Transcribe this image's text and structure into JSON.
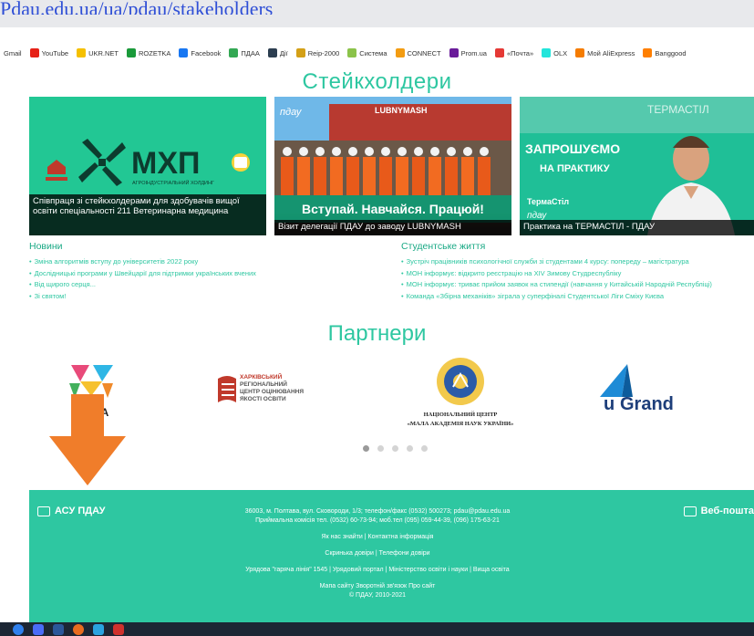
{
  "top_link": "Pdau.edu.ua/ua/pdau/stakeholders",
  "bookmarks": [
    {
      "label": "Gmail",
      "color": "#ffffff"
    },
    {
      "label": "YouTube",
      "color": "#e62117"
    },
    {
      "label": "UKR.NET",
      "color": "#f5c000"
    },
    {
      "label": "ROZETKA",
      "color": "#1a9a3a"
    },
    {
      "label": "Facebook",
      "color": "#1877f2"
    },
    {
      "label": "ПДАА",
      "color": "#33a854"
    },
    {
      "label": "Дії",
      "color": "#2c3e50"
    },
    {
      "label": "Reip-2000",
      "color": "#d4a017"
    },
    {
      "label": "Система",
      "color": "#8bc34a"
    },
    {
      "label": "CONNECT",
      "color": "#f39c12"
    },
    {
      "label": "Prom.ua",
      "color": "#6a1b9a"
    },
    {
      "label": "«Почта»",
      "color": "#e53935"
    },
    {
      "label": "OLX",
      "color": "#23e5db"
    },
    {
      "label": "Мой AliExpress",
      "color": "#f57c00"
    },
    {
      "label": "Banggood",
      "color": "#ff7f00"
    }
  ],
  "stakeholders_title": "Стейкхолдери",
  "cards": [
    {
      "caption": "Співпраця зі стейкхолдерами для здобувачів вищої освіти спеціальності 211 Ветеринарна медицина",
      "logo": "МХП",
      "logo_sub": "АГРОІНДУСТРІАЛЬНИЙ ХОЛДИНГ"
    },
    {
      "caption": "Візит делегації ПДАУ до заводу LUBNYMASH",
      "banner": "Вступай. Навчайся. Працюй!",
      "corner": "пдау",
      "sign": "LUBNYMASH"
    },
    {
      "caption": "Практика на ТЕРМАСТІЛ - ПДАУ",
      "headline1": "ЗАПРОШУЄМО",
      "headline2": "НА ПРАКТИКУ",
      "brand": "ТермаСтіл",
      "corner": "пдау",
      "sign": "ТЕРМАСТІЛ"
    }
  ],
  "news": {
    "title": "Новини",
    "items": [
      "Зміна алгоритмів вступу до університетів 2022 року",
      "Дослідницькі програми у Швейцарії для підтримки українських вчених",
      "Від щирого серця...",
      "Зі святом!"
    ]
  },
  "student_life": {
    "title": "Студентське життя",
    "items": [
      "Зустріч працівників психологічної служби зі студентами 4 курсу: попереду – магістратура",
      "МОН інформує: відкрито реєстрацію на XIV Зимову Студреспубліку",
      "МОН інформує: триває прийом заявок на стипендії (навчання у Китайській Народній Республіці)",
      "Команда «Збірна механіків» зіграла у суперфіналі Студентської Ліги Сміху Києва"
    ]
  },
  "partners_title": "Партнери",
  "partners": [
    {
      "label": "BA"
    },
    {
      "label": "ХАРКІВСЬКИЙ РЕГІОНАЛЬНИЙ ЦЕНТР ОЦІНЮВАННЯ ЯКОСТІ ОСВІТИ"
    },
    {
      "label": "НАЦІОНАЛЬНИЙ ЦЕНТР «МАЛА АКАДЕМІЯ НАУК УКРАЇНИ»"
    },
    {
      "label": "Grand"
    }
  ],
  "footer": {
    "brand": "АСУ ПДАУ",
    "mail": "Веб-пошта",
    "address": "36003, м. Полтава, вул. Сковороди, 1/3; телефон/факс (0532) 500273; pdau@pdau.edu.ua",
    "admissions": "Приймальна комісія тел. (0532) 60-73-94; моб.тел (095) 059-44-39, (096) 175-63-21",
    "links1": "Як нас знайти | Контактна інформація",
    "links2": "Скринька довіри | Телефони довіри",
    "links3": "Урядова \"гаряча лінія\" 1545 | Урядовий портал | Міністерство освіти і науки | Вища освіта",
    "links4": "Мапа сайту   Зворотній зв'язок   Про сайт",
    "copyright": "© ПДАУ, 2010-2021"
  },
  "colors": {
    "accent": "#2ec7a1",
    "arrow": "#f07d2a"
  }
}
